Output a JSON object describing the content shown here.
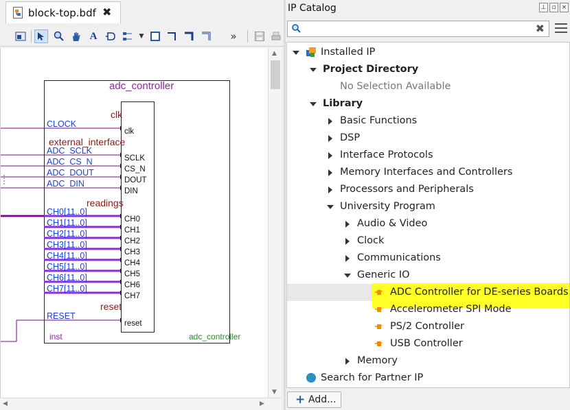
{
  "editor": {
    "tab_title": "block-top.bdf",
    "tab_close": "✖",
    "toolbar_more": "»"
  },
  "schematic": {
    "block_title": "adc_controller",
    "instance_name": "inst",
    "block_footer": "adc_controller",
    "groups": {
      "clk": "clk",
      "external_interface": "external_interface",
      "readings": "readings",
      "reset": "reset"
    },
    "inputs": [
      "CLOCK",
      "ADC_SCLK",
      "ADC_CS_N",
      "ADC_DOUT",
      "ADC_DIN",
      "CH0[11..0]",
      "CH1[11..0]",
      "CH2[11..0]",
      "CH3[11..0]",
      "CH4[11..0]",
      "CH5[11..0]",
      "CH6[11..0]",
      "CH7[11..0]",
      "RESET"
    ],
    "ports": [
      "clk",
      "SCLK",
      "CS_N",
      "DOUT",
      "DIN",
      "CH0",
      "CH1",
      "CH2",
      "CH3",
      "CH4",
      "CH5",
      "CH6",
      "CH7",
      "reset"
    ]
  },
  "catalog": {
    "title": "IP Catalog",
    "search_value": "",
    "clear_icon": "✖",
    "tree": [
      {
        "label": "Installed IP",
        "level": 0,
        "arrow": "down",
        "icon": "ip-folder-icon"
      },
      {
        "label": "Project Directory",
        "level": 1,
        "arrow": "down",
        "bold": true
      },
      {
        "label": "No Selection Available",
        "level": 2,
        "muted": true
      },
      {
        "label": "Library",
        "level": 1,
        "arrow": "down",
        "bold": true
      },
      {
        "label": "Basic Functions",
        "level": 2,
        "arrow": "right"
      },
      {
        "label": "DSP",
        "level": 2,
        "arrow": "right"
      },
      {
        "label": "Interface Protocols",
        "level": 2,
        "arrow": "right"
      },
      {
        "label": "Memory Interfaces and Controllers",
        "level": 2,
        "arrow": "right"
      },
      {
        "label": "Processors and Peripherals",
        "level": 2,
        "arrow": "right"
      },
      {
        "label": "University Program",
        "level": 2,
        "arrow": "down"
      },
      {
        "label": "Audio & Video",
        "level": 3,
        "arrow": "right"
      },
      {
        "label": "Clock",
        "level": 3,
        "arrow": "right"
      },
      {
        "label": "Communications",
        "level": 3,
        "arrow": "right"
      },
      {
        "label": "Generic IO",
        "level": 3,
        "arrow": "down"
      },
      {
        "label": "ADC Controller for DE-series Boards",
        "level": 4,
        "icon": "ip-core-icon",
        "highlighted": true
      },
      {
        "label": "Accelerometer SPI Mode",
        "level": 4,
        "icon": "ip-core-icon"
      },
      {
        "label": "PS/2 Controller",
        "level": 4,
        "icon": "ip-core-icon"
      },
      {
        "label": "USB Controller",
        "level": 4,
        "icon": "ip-core-icon"
      },
      {
        "label": "Memory",
        "level": 3,
        "arrow": "right"
      },
      {
        "label": "Search for Partner IP",
        "level": 0,
        "icon": "globe-icon"
      }
    ],
    "add_button": "Add..."
  },
  "colors": {
    "highlight": "#ffff26",
    "block_border": "#222222",
    "wire_purple": "#800080",
    "bus_purple": "#8a2be2",
    "label_blue": "#1a3fe0",
    "group_red": "#8b1a1a",
    "title_purple": "#8a2c9a",
    "footer_green": "#2a8a2a"
  }
}
